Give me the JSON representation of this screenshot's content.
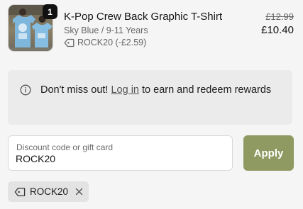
{
  "line_item": {
    "quantity": "1",
    "name": "K-Pop Crew Back Graphic T-Shirt",
    "variant": "Sky Blue / 9-11 Years",
    "discount": "ROCK20 (-£2.59)",
    "compare_price": "£12.99",
    "price": "£10.40",
    "thumbnail_icon": "tshirt-photo"
  },
  "notice": {
    "icon": "info-icon",
    "text_before": "Don't miss out! ",
    "link_text": "Log in",
    "text_after": " to earn and redeem rewards"
  },
  "discount_form": {
    "label": "Discount code or gift card",
    "value": "ROCK20",
    "apply_label": "Apply",
    "apply_color": "#8e9a62"
  },
  "applied_codes": [
    {
      "code": "ROCK20",
      "icon": "tag-icon",
      "remove_icon": "close-icon"
    }
  ]
}
